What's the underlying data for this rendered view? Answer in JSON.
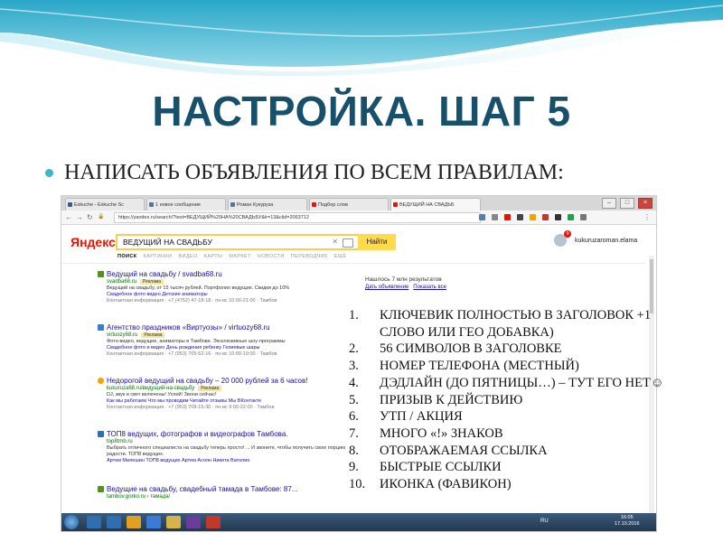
{
  "slide": {
    "title": "НАСТРОЙКА. ШАГ 5",
    "bullet": "НАПИСАТЬ ОБЪЯВЛЕНИЯ ПО ВСЕМ ПРАВИЛАМ:",
    "accent_color": "#17506a",
    "bullet_color": "#3fb6c6"
  },
  "browser": {
    "tabs": [
      {
        "label": "Eskuche - Eskuche Sc",
        "favicon_color": "#3b5998",
        "active": false
      },
      {
        "label": "1 новое сообщение",
        "favicon_color": "#4a76a8",
        "active": false
      },
      {
        "label": "Роман Кукуруза",
        "favicon_color": "#4a76a8",
        "active": false
      },
      {
        "label": "Подбор слов",
        "favicon_color": "#e61400",
        "active": false
      },
      {
        "label": "ВЕДУЩИЙ НА СВАДЬБ",
        "favicon_color": "#e61400",
        "active": true
      }
    ],
    "url": "https://yandex.ru/search/?text=ВЕДУЩИЙ%20НА%20СВАДЬБУ&lr=13&clid=2063712",
    "extension_colors": [
      "#5b7bb5",
      "#888888",
      "#e61400",
      "#444444",
      "#f0a400",
      "#c0392b",
      "#333333",
      "#2a9d4b",
      "#777777"
    ]
  },
  "yandex": {
    "logo": "Яндекс",
    "query": "ВЕДУЩИЙ НА СВАДЬБУ",
    "find_label": "Найти",
    "notification_count": "9",
    "username": "kukuruzaroman.elama",
    "verticals": [
      "ПОИСК",
      "КАРТИНКИ",
      "ВИДЕО",
      "КАРТЫ",
      "МАРКЕТ",
      "НОВОСТИ",
      "ПЕРЕВОДЧИК",
      "ЕЩЁ"
    ],
    "stats": "Нашлось 7 млн результатов",
    "stats_links": [
      "Дать объявление",
      "Показать все"
    ],
    "results": [
      {
        "title": "Ведущий на свадьбу / svadba68.ru",
        "url": "svadba68.ru",
        "badge": "Реклама",
        "text": "Ведущий на свадьбу, от 15 тысяч рублей. Портфолио ведущих. Скидки до 10%",
        "links": "Свадебное фото видео   Детские аниматоры",
        "contact": "Контактная информация · +7 (4752) 47-18-18 · пн-вс 10:00-21:00 · Тамбов",
        "icon_color": "#5b8c2a"
      },
      {
        "title": "Агентство праздников «Виртуозы» / virtuozy68.ru",
        "url": "virtuozy68.ru",
        "badge": "Реклама",
        "text": "Фото-видео, ведущие, аниматоры в Тамбове. Эксклюзивные шоу-программы",
        "links": "Свадебное фото и видео   День рождения ребенку   Гелиевые шары",
        "contact": "Контактная информация · +7 (953) 705-52-16 · пн-вс 10:00-19:00 · Тамбов",
        "icon_color": "#3a7bd5"
      },
      {
        "title": "Недорогой ведущий на свадьбу – 20 000 рублей за 6 часов!",
        "url": "kukuruza68.ru/ведущий-на-свадьбу",
        "badge": "Реклама",
        "text": "DJ, звук и свет включены! Успей! Звони сейчас!",
        "links": "Как мы работаем   Что мы проводим   Читайте отзывы   Мы ВКонтакте",
        "contact": "Контактная информация · +7 (953) 708-15-30 · пн-вс 9:00-22:00 · Тамбов",
        "icon_color": "#f0a400"
      },
      {
        "title": "ТОП8 ведущих, фотографов и видеографов Тамбова.",
        "url": "top8tmb.ru",
        "badge": "",
        "text": "Выбрать отличного специалиста на свадьбу теперь просто! ... И звоните, чтобы получить свою порцию радости. ТОП8 ведущих.",
        "links": "Артем Милешин   ТОП8 ведущих   Артем Асоян   Никита Ватолин",
        "contact": "",
        "icon_color": "#2c6fb7"
      },
      {
        "title": "Ведущие на свадьбу, свадебный тамада в Тамбове: 87...",
        "url": "tambov.gorko.ru › тамада/",
        "badge": "",
        "text": "",
        "links": "",
        "contact": "",
        "icon_color": "#5b8c2a"
      }
    ]
  },
  "taskbar": {
    "items": [
      "#2f6fb0",
      "#2f6fb0",
      "#e0a020",
      "#3a7bd5",
      "#d8b24a",
      "#6a3d9a",
      "#c0392b"
    ],
    "lang": "RU",
    "time": "16:05",
    "date": "17.10.2016"
  },
  "rules": [
    {
      "num": "1.",
      "text": "КЛЮЧЕВИК ПОЛНОСТЬЮ В ЗАГОЛОВОК +1 СЛОВО ИЛИ ГЕО ДОБАВКА)"
    },
    {
      "num": "2.",
      "text": "56 СИМВОЛОВ В ЗАГОЛОВКЕ"
    },
    {
      "num": "3.",
      "text": "НОМЕР ТЕЛЕФОНА (МЕСТНЫЙ)"
    },
    {
      "num": "4.",
      "text": "ДЭДЛАЙН (ДО ПЯТНИЦЫ…) – ТУТ ЕГО НЕТ☺"
    },
    {
      "num": "5.",
      "text": "ПРИЗЫВ К ДЕЙСТВИЮ"
    },
    {
      "num": "6.",
      "text": "УТП / АКЦИЯ"
    },
    {
      "num": "7.",
      "text": "МНОГО «!» ЗНАКОВ"
    },
    {
      "num": "8.",
      "text": "ОТОБРАЖАЕМАЯ ССЫЛКА"
    },
    {
      "num": "9.",
      "text": "БЫСТРЫЕ ССЫЛКИ"
    },
    {
      "num": "10.",
      "text": "ИКОНКА (ФАВИКОН)"
    }
  ]
}
